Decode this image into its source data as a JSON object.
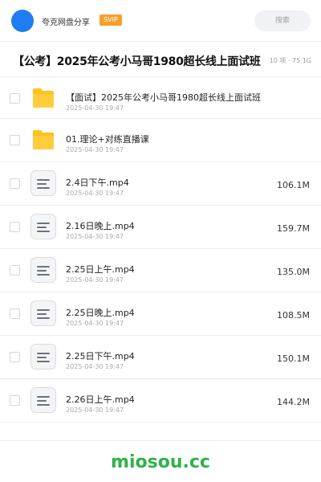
{
  "header": {
    "share_name": "夸克网盘分享",
    "badge": "SVIP",
    "search_placeholder": "搜索"
  },
  "title_row": {
    "title": "【公考】2025年公考小马哥1980超长线上面试班",
    "summary": "10 项 · 75.1G"
  },
  "items": [
    {
      "type": "folder",
      "name": "【面试】2025年公考小马哥1980超长线上面试班",
      "date": "2025-04-30 19:47",
      "size": ""
    },
    {
      "type": "folder",
      "name": "01.理论+对练直播课",
      "date": "2025-04-30 19:47",
      "size": ""
    },
    {
      "type": "file",
      "name": "2.4日下午.mp4",
      "date": "2025-04-30 19:47",
      "size": "106.1M"
    },
    {
      "type": "file",
      "name": "2.16日晚上.mp4",
      "date": "2025-04-30 19:47",
      "size": "159.7M"
    },
    {
      "type": "file",
      "name": "2.25日上午.mp4",
      "date": "2025-04-30 19:47",
      "size": "135.0M"
    },
    {
      "type": "file",
      "name": "2.25日晚上.mp4",
      "date": "2025-04-30 19:47",
      "size": "108.5M"
    },
    {
      "type": "file",
      "name": "2.25日下午.mp4",
      "date": "2025-04-30 19:47",
      "size": "150.1M"
    },
    {
      "type": "file",
      "name": "2.26日上午.mp4",
      "date": "2025-04-30 19:47",
      "size": "144.2M"
    }
  ],
  "footer": {
    "watermark": "miosou.cc"
  },
  "colors": {
    "avatar": "#1f7cf2",
    "svip_badge": "#f6a02b",
    "folder": "#ffc21c",
    "watermark": "#2db34a"
  }
}
